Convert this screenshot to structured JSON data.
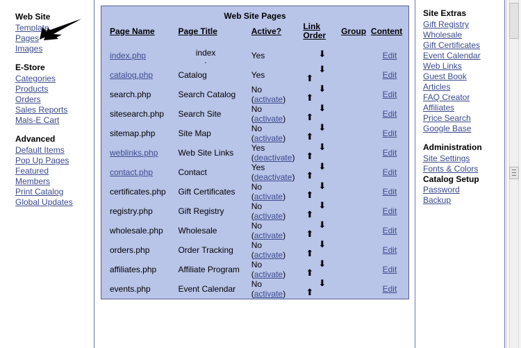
{
  "left_sidebar": {
    "groups": [
      {
        "heading": "Web Site",
        "items": [
          {
            "label": "Template"
          },
          {
            "label": "Pages"
          },
          {
            "label": "Images"
          }
        ]
      },
      {
        "heading": "E-Store",
        "items": [
          {
            "label": "Categories"
          },
          {
            "label": "Products"
          },
          {
            "label": "Orders"
          },
          {
            "label": "Sales Reports"
          },
          {
            "label": "Mals-E Cart"
          }
        ]
      },
      {
        "heading": "Advanced",
        "items": [
          {
            "label": "Default Items"
          },
          {
            "label": "Pop Up Pages"
          },
          {
            "label": "Featured"
          },
          {
            "label": "Members"
          },
          {
            "label": "Print Catalog"
          },
          {
            "label": "Global Updates"
          }
        ]
      }
    ]
  },
  "annotation": {
    "icon": "arrow-pointer-icon",
    "points_at": "Pages"
  },
  "table": {
    "title": "Web Site Pages",
    "columns": [
      {
        "label": "Page Name"
      },
      {
        "label": "Page Title"
      },
      {
        "label": "Active?"
      },
      {
        "label_line1": "Link",
        "label_line2": "Order"
      },
      {
        "label": "Group"
      },
      {
        "label": "Content"
      }
    ],
    "rows": [
      {
        "page_name": "index.php",
        "name_is_link": true,
        "page_title": "index",
        "title_dot": ".",
        "active": "Yes",
        "toggle": "",
        "up": false,
        "down": true,
        "group": "",
        "content": "Edit"
      },
      {
        "page_name": "catalog.php",
        "name_is_link": true,
        "page_title": "Catalog",
        "active": "Yes",
        "toggle": "",
        "up": true,
        "down": true,
        "group": "",
        "content": "Edit"
      },
      {
        "page_name": "search.php",
        "name_is_link": false,
        "page_title": "Search Catalog",
        "active": "No",
        "toggle": "activate",
        "up": true,
        "down": true,
        "group": "",
        "content": "Edit"
      },
      {
        "page_name": "sitesearch.php",
        "name_is_link": false,
        "page_title": "Search Site",
        "active": "No",
        "toggle": "activate",
        "up": true,
        "down": true,
        "group": "",
        "content": "Edit"
      },
      {
        "page_name": "sitemap.php",
        "name_is_link": false,
        "page_title": "Site Map",
        "active": "No",
        "toggle": "activate",
        "up": true,
        "down": true,
        "group": "",
        "content": "Edit"
      },
      {
        "page_name": "weblinks.php",
        "name_is_link": true,
        "page_title": "Web Site Links",
        "active": "Yes",
        "toggle": "deactivate",
        "up": true,
        "down": true,
        "group": "",
        "content": "Edit"
      },
      {
        "page_name": "contact.php",
        "name_is_link": true,
        "page_title": "Contact",
        "active": "Yes",
        "toggle": "deactivate",
        "up": true,
        "down": true,
        "group": "",
        "content": "Edit"
      },
      {
        "page_name": "certificates.php",
        "name_is_link": false,
        "page_title": "Gift Certificates",
        "active": "No",
        "toggle": "activate",
        "up": true,
        "down": true,
        "group": "",
        "content": "Edit"
      },
      {
        "page_name": "registry.php",
        "name_is_link": false,
        "page_title": "Gift Registry",
        "active": "No",
        "toggle": "activate",
        "up": true,
        "down": true,
        "group": "",
        "content": "Edit"
      },
      {
        "page_name": "wholesale.php",
        "name_is_link": false,
        "page_title": "Wholesale",
        "active": "No",
        "toggle": "activate",
        "up": true,
        "down": true,
        "group": "",
        "content": "Edit"
      },
      {
        "page_name": "orders.php",
        "name_is_link": false,
        "page_title": "Order Tracking",
        "active": "No",
        "toggle": "activate",
        "up": true,
        "down": true,
        "group": "",
        "content": "Edit"
      },
      {
        "page_name": "affiliates.php",
        "name_is_link": false,
        "page_title": "Affiliate Program",
        "active": "No",
        "toggle": "activate",
        "up": true,
        "down": true,
        "group": "",
        "content": "Edit"
      },
      {
        "page_name": "events.php",
        "name_is_link": false,
        "page_title": "Event Calendar",
        "active": "No",
        "toggle": "activate",
        "up": true,
        "down": true,
        "group": "",
        "content": "Edit"
      }
    ]
  },
  "right_sidebar": {
    "groups": [
      {
        "heading": "Site Extras",
        "items": [
          {
            "label": "Gift Registry",
            "bold": false
          },
          {
            "label": "Wholesale",
            "bold": false
          },
          {
            "label": "Gift Certificates",
            "bold": false
          },
          {
            "label": "Event Calendar",
            "bold": false
          },
          {
            "label": "Web Links",
            "bold": false
          },
          {
            "label": "Guest Book",
            "bold": false
          },
          {
            "label": "Articles",
            "bold": false
          },
          {
            "label": "FAQ Creator",
            "bold": false
          },
          {
            "label": "Affiliates",
            "bold": false
          },
          {
            "label": "Price Search",
            "bold": false
          },
          {
            "label": "Google Base",
            "bold": false
          }
        ]
      },
      {
        "heading": "Administration",
        "items": [
          {
            "label": "Site Settings",
            "bold": false
          },
          {
            "label": "Fonts & Colors",
            "bold": false
          },
          {
            "label": "Catalog Setup",
            "bold": true
          },
          {
            "label": "Password",
            "bold": false
          },
          {
            "label": "Backup",
            "bold": false
          }
        ]
      }
    ]
  },
  "scrollbar": {
    "name": "vertical-scrollbar",
    "thumb_position": "top"
  },
  "colors": {
    "table_bg": "#b9c4e9",
    "table_border": "#555f91",
    "link": "#3b4a8c",
    "page_bg": "#ffffff",
    "divider": "#6a74a8"
  }
}
